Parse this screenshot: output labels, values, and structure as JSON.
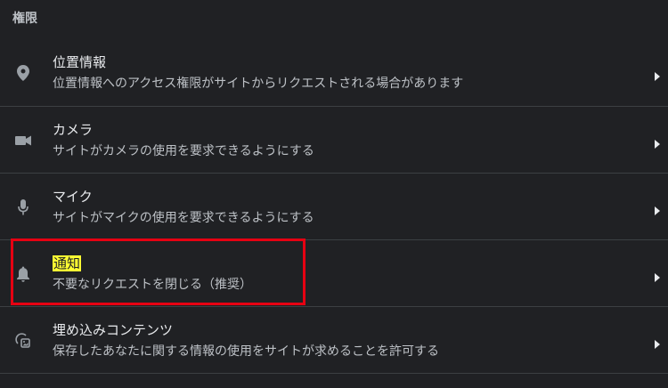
{
  "section": {
    "title": "権限"
  },
  "rows": [
    {
      "title": "位置情報",
      "description": "位置情報へのアクセス権限がサイトからリクエストされる場合があります",
      "icon": "location-pin-icon"
    },
    {
      "title": "カメラ",
      "description": "サイトがカメラの使用を要求できるようにする",
      "icon": "camera-icon"
    },
    {
      "title": "マイク",
      "description": "サイトがマイクの使用を要求できるようにする",
      "icon": "microphone-icon"
    },
    {
      "title": "通知",
      "description": "不要なリクエストを閉じる（推奨）",
      "icon": "bell-icon"
    },
    {
      "title": "埋め込みコンテンツ",
      "description": "保存したあなたに関する情報の使用をサイトが求めることを許可する",
      "icon": "embedded-content-icon"
    }
  ],
  "colors": {
    "background": "#202124",
    "highlight": "#ffff33",
    "annotation": "#e60012"
  }
}
